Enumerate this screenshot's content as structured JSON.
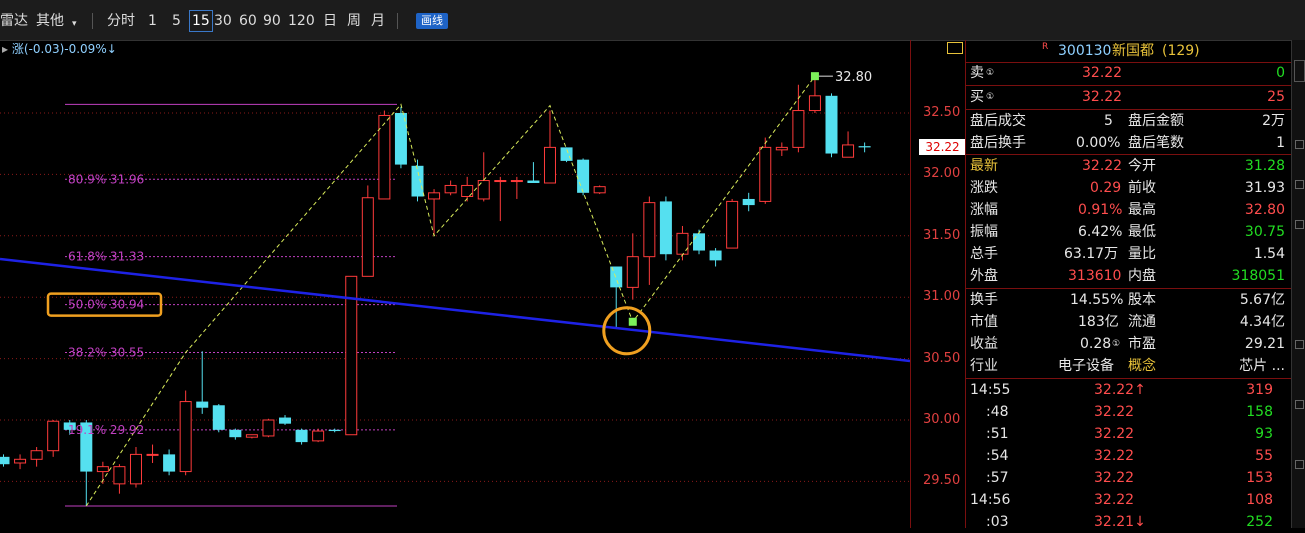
{
  "toolbar": {
    "radar": "雷达",
    "other": "其他",
    "periods": [
      "分时",
      "1",
      "5",
      "15",
      "30",
      "60",
      "90",
      "120",
      "日",
      "周",
      "月"
    ],
    "active_period": "15",
    "line_button": "画线"
  },
  "chart": {
    "info": "涨(-0.03)-0.09%↓",
    "price_labels": [
      "32.50",
      "32.00",
      "31.50",
      "31.00",
      "30.50",
      "30.00",
      "29.50"
    ],
    "current_price_tag": "32.22",
    "peak_label": "32.80",
    "fib_levels": [
      {
        "label": "80.9% 31.96",
        "price": 31.96
      },
      {
        "label": "61.8% 31.33",
        "price": 31.33
      },
      {
        "label": "50.0% 30.94",
        "price": 30.94
      },
      {
        "label": "38.2% 30.55",
        "price": 30.55
      },
      {
        "label": "19.1% 29.92",
        "price": 29.92
      }
    ],
    "fib_top": 32.57,
    "fib_bottom": 29.3,
    "highlighted_level": "50.0% 30.94",
    "candles": [
      {
        "o": 29.7,
        "c": 29.64,
        "h": 29.72,
        "l": 29.62
      },
      {
        "o": 29.65,
        "c": 29.68,
        "h": 29.72,
        "l": 29.6
      },
      {
        "o": 29.68,
        "c": 29.75,
        "h": 29.78,
        "l": 29.62
      },
      {
        "o": 29.75,
        "c": 29.99,
        "h": 30.0,
        "l": 29.7
      },
      {
        "o": 29.98,
        "c": 29.92,
        "h": 30.0,
        "l": 29.88
      },
      {
        "o": 29.98,
        "c": 29.58,
        "h": 30.0,
        "l": 29.3
      },
      {
        "o": 29.58,
        "c": 29.62,
        "h": 29.66,
        "l": 29.48
      },
      {
        "o": 29.48,
        "c": 29.62,
        "h": 29.64,
        "l": 29.4
      },
      {
        "o": 29.48,
        "c": 29.72,
        "h": 29.78,
        "l": 29.45
      },
      {
        "o": 29.72,
        "c": 29.72,
        "h": 29.8,
        "l": 29.65
      },
      {
        "o": 29.72,
        "c": 29.58,
        "h": 29.76,
        "l": 29.55
      },
      {
        "o": 29.58,
        "c": 30.15,
        "h": 30.24,
        "l": 29.55
      },
      {
        "o": 30.15,
        "c": 30.1,
        "h": 30.56,
        "l": 30.05
      },
      {
        "o": 30.12,
        "c": 29.92,
        "h": 30.13,
        "l": 29.9
      },
      {
        "o": 29.92,
        "c": 29.86,
        "h": 29.93,
        "l": 29.84
      },
      {
        "o": 29.86,
        "c": 29.88,
        "h": 29.88,
        "l": 29.85
      },
      {
        "o": 29.87,
        "c": 30.0,
        "h": 30.01,
        "l": 29.86
      },
      {
        "o": 30.02,
        "c": 29.97,
        "h": 30.04,
        "l": 29.96
      },
      {
        "o": 29.92,
        "c": 29.82,
        "h": 29.93,
        "l": 29.8
      },
      {
        "o": 29.83,
        "c": 29.91,
        "h": 29.93,
        "l": 29.82
      },
      {
        "o": 29.92,
        "c": 29.91,
        "h": 29.93,
        "l": 29.9
      },
      {
        "o": 29.88,
        "c": 31.17,
        "h": 31.17,
        "l": 29.88
      },
      {
        "o": 31.17,
        "c": 31.81,
        "h": 31.91,
        "l": 31.17
      },
      {
        "o": 31.8,
        "c": 32.48,
        "h": 32.52,
        "l": 31.8
      },
      {
        "o": 32.5,
        "c": 32.08,
        "h": 32.55,
        "l": 32.05
      },
      {
        "o": 32.07,
        "c": 31.82,
        "h": 32.12,
        "l": 31.78
      },
      {
        "o": 31.8,
        "c": 31.85,
        "h": 31.88,
        "l": 31.5
      },
      {
        "o": 31.85,
        "c": 31.91,
        "h": 31.95,
        "l": 31.83
      },
      {
        "o": 31.82,
        "c": 31.91,
        "h": 31.98,
        "l": 31.78
      },
      {
        "o": 31.8,
        "c": 31.95,
        "h": 32.18,
        "l": 31.78
      },
      {
        "o": 31.95,
        "c": 31.95,
        "h": 31.98,
        "l": 31.62
      },
      {
        "o": 31.95,
        "c": 31.95,
        "h": 31.98,
        "l": 31.8
      },
      {
        "o": 31.95,
        "c": 31.93,
        "h": 32.1,
        "l": 31.93
      },
      {
        "o": 31.93,
        "c": 32.22,
        "h": 32.52,
        "l": 31.93
      },
      {
        "o": 32.22,
        "c": 32.11,
        "h": 32.22,
        "l": 32.1
      },
      {
        "o": 32.12,
        "c": 31.85,
        "h": 32.13,
        "l": 31.83
      },
      {
        "o": 31.85,
        "c": 31.9,
        "h": 31.91,
        "l": 31.84
      },
      {
        "o": 31.25,
        "c": 31.08,
        "h": 31.08,
        "l": 30.75
      },
      {
        "o": 31.08,
        "c": 31.33,
        "h": 31.52,
        "l": 30.98
      },
      {
        "o": 31.33,
        "c": 31.77,
        "h": 31.82,
        "l": 31.1
      },
      {
        "o": 31.78,
        "c": 31.35,
        "h": 31.82,
        "l": 31.3
      },
      {
        "o": 31.35,
        "c": 31.52,
        "h": 31.58,
        "l": 31.3
      },
      {
        "o": 31.52,
        "c": 31.38,
        "h": 31.55,
        "l": 31.35
      },
      {
        "o": 31.38,
        "c": 31.3,
        "h": 31.4,
        "l": 31.25
      },
      {
        "o": 31.4,
        "c": 31.78,
        "h": 31.8,
        "l": 31.4
      },
      {
        "o": 31.8,
        "c": 31.75,
        "h": 31.85,
        "l": 31.7
      },
      {
        "o": 31.78,
        "c": 32.22,
        "h": 32.3,
        "l": 31.76
      },
      {
        "o": 32.2,
        "c": 32.22,
        "h": 32.26,
        "l": 32.15
      },
      {
        "o": 32.22,
        "c": 32.52,
        "h": 32.73,
        "l": 32.18
      },
      {
        "o": 32.52,
        "c": 32.64,
        "h": 32.8,
        "l": 32.5
      },
      {
        "o": 32.64,
        "c": 32.17,
        "h": 32.66,
        "l": 32.14
      },
      {
        "o": 32.14,
        "c": 32.24,
        "h": 32.35,
        "l": 32.14
      },
      {
        "o": 32.23,
        "c": 32.22,
        "h": 32.26,
        "l": 32.18
      }
    ],
    "zigzag": [
      [
        5,
        29.3
      ],
      [
        11,
        30.55
      ],
      [
        24,
        32.57
      ],
      [
        26,
        31.5
      ],
      [
        33,
        32.56
      ],
      [
        38,
        30.8
      ],
      [
        39,
        30.98
      ],
      [
        49,
        32.8
      ]
    ]
  },
  "quote": {
    "code": "300130",
    "name": "新国都",
    "count": "(129)",
    "sell_label": "卖",
    "sell_price": "32.22",
    "sell_vol": "0",
    "buy_label": "买",
    "buy_price": "32.22",
    "buy_vol": "25",
    "after_deal_label": "盘后成交",
    "after_deal_val": "5",
    "after_amount_label": "盘后金额",
    "after_amount_val": "2万",
    "after_turnover_label": "盘后换手",
    "after_turnover_val": "0.00%",
    "after_count_label": "盘后笔数",
    "after_count_val": "1",
    "latest_label": "最新",
    "latest_val": "32.22",
    "open_label": "今开",
    "open_val": "31.28",
    "change_label": "涨跌",
    "change_val": "0.29",
    "prev_label": "前收",
    "prev_val": "31.93",
    "pct_label": "涨幅",
    "pct_val": "0.91%",
    "high_label": "最高",
    "high_val": "32.80",
    "amp_label": "振幅",
    "amp_val": "6.42%",
    "low_label": "最低",
    "low_val": "30.75",
    "vol_label": "总手",
    "vol_val": "63.17万",
    "ratio_label": "量比",
    "ratio_val": "1.54",
    "outer_label": "外盘",
    "outer_val": "313610",
    "inner_label": "内盘",
    "inner_val": "318051",
    "turn_label": "换手",
    "turn_val": "14.55%",
    "equity_label": "股本",
    "equity_val": "5.67亿",
    "mcap_label": "市值",
    "mcap_val": "183亿",
    "float_label": "流通",
    "float_val": "4.34亿",
    "eps_label": "收益",
    "eps_val": "0.28",
    "pe_label": "市盈",
    "pe_val": "29.21",
    "industry_label": "行业",
    "industry_val": "电子设备",
    "concept_label": "概念",
    "concept_val": "芯片 ..."
  },
  "ticks": [
    {
      "time": "14:55",
      "price": "32.22↑",
      "vol": "319",
      "color": "red"
    },
    {
      "time": ":48",
      "price": "32.22",
      "vol": "158",
      "color": "green"
    },
    {
      "time": ":51",
      "price": "32.22",
      "vol": "93",
      "color": "green"
    },
    {
      "time": ":54",
      "price": "32.22",
      "vol": "55",
      "color": "red"
    },
    {
      "time": ":57",
      "price": "32.22",
      "vol": "153",
      "color": "red"
    },
    {
      "time": "14:56",
      "price": "32.22",
      "vol": "108",
      "color": "red"
    },
    {
      "time": ":03",
      "price": "32.21↓",
      "vol": "252",
      "color": "green"
    }
  ],
  "colors": {
    "up": "#ff3b3b",
    "down": "#55e0f0",
    "fib": "#c040c0",
    "trend": "#1e22e6",
    "zig": "#d8ea5a",
    "highlight": "#f0a020",
    "grid": "#8a1a1a"
  }
}
